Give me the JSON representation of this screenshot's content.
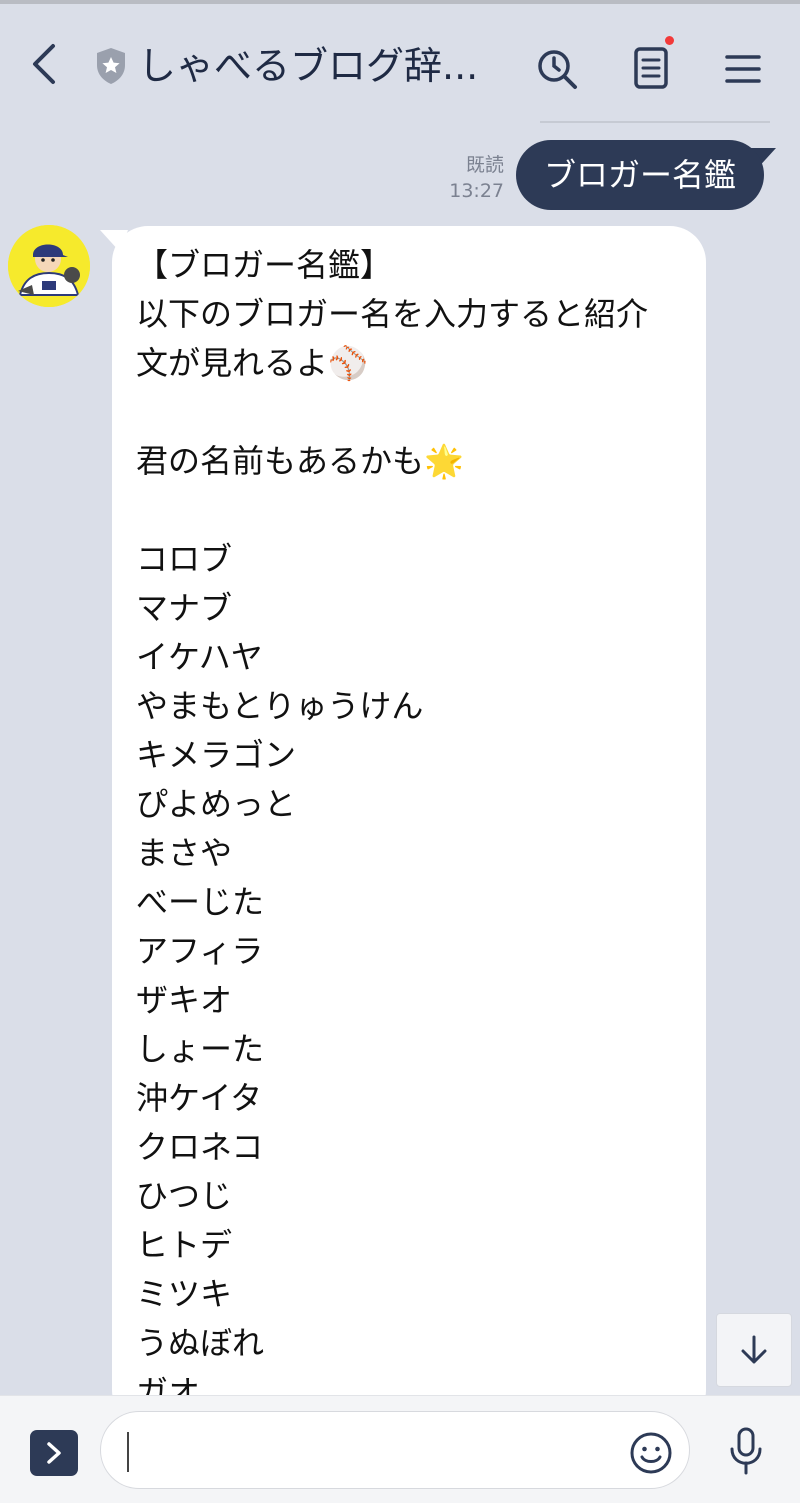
{
  "header": {
    "title": "しゃべるブログ辞...",
    "icons": {
      "back": "chevron-left-icon",
      "shield": "shield-star-icon",
      "search": "clock-search-icon",
      "notes": "note-icon",
      "menu": "hamburger-menu-icon"
    },
    "notes_badge_color": "#f23a3a"
  },
  "chat": {
    "sent_message": {
      "text": "ブロガー名鑑",
      "read_label": "既読",
      "time": "13:27",
      "bubble_color": "#2d3a56"
    },
    "received_message": {
      "lines": [
        "【ブロガー名鑑】",
        "以下のブロガー名を入力すると紹介",
        "文が見れるよ⚾",
        "",
        "君の名前もあるかも🌟",
        "",
        "コロブ",
        "マナブ",
        "イケハヤ",
        "やまもとりゅうけん",
        "キメラゴン",
        "ぴよめっと",
        "まさや",
        "べーじた",
        "アフィラ",
        "ザキオ",
        "しょーた",
        "沖ケイタ",
        "クロネコ",
        "ひつじ",
        "ヒトデ",
        "ミツキ",
        "うぬぼれ",
        "ガオ"
      ]
    },
    "avatar_background": "#f6ea2c"
  },
  "scroll_down_icon": "arrow-down-icon",
  "footer": {
    "input_value": "",
    "icons": {
      "expand": "chevron-right-icon",
      "emoji": "smiley-icon",
      "mic": "microphone-icon"
    }
  },
  "colors": {
    "background": "#dadee8",
    "accent": "#2d3a56"
  }
}
